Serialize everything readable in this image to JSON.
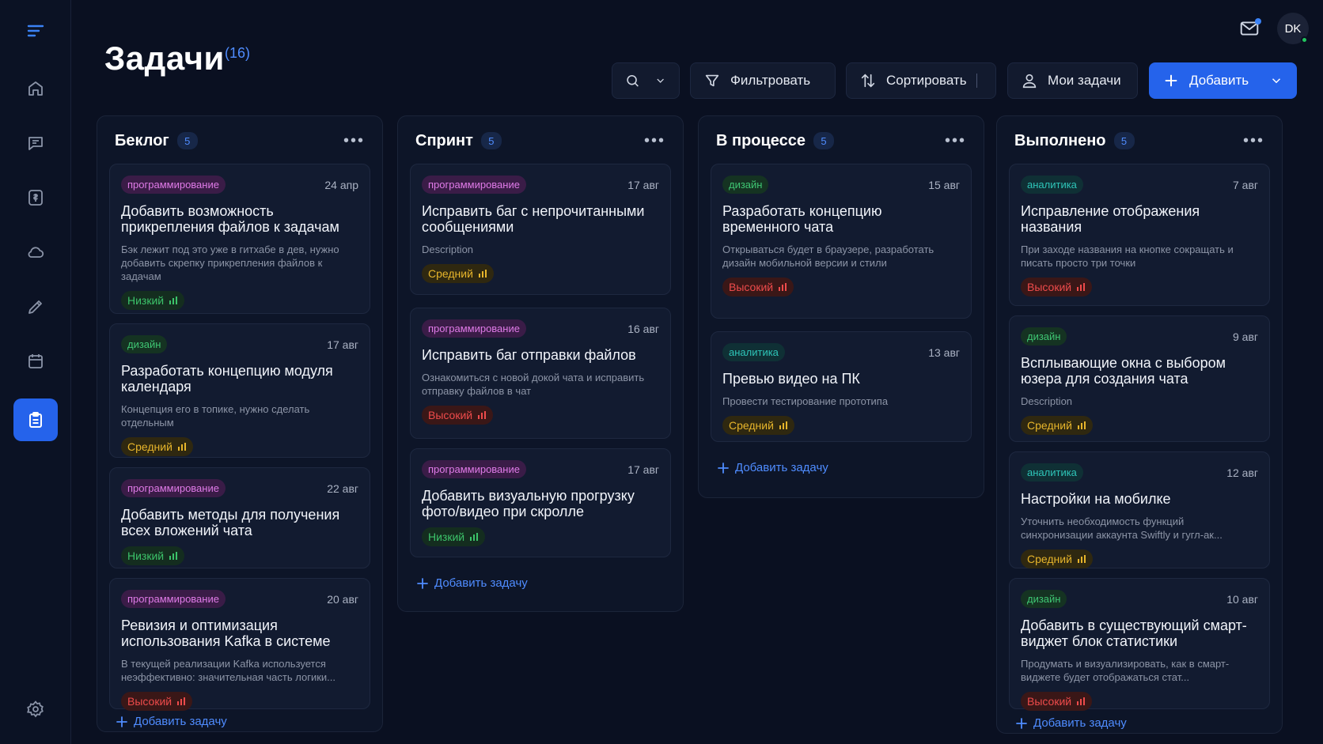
{
  "page": {
    "title": "Задачи",
    "count": "(16)"
  },
  "user": {
    "initials": "DK"
  },
  "toolbar": {
    "filter_label": "Фильтровать",
    "sort_label": "Сортировать",
    "my_tasks_label": "Мои задачи",
    "add_label": "Добавить"
  },
  "add_task_label": "Добавить задачу",
  "columns": [
    {
      "title": "Беклог",
      "count": "5",
      "cards": [
        {
          "tag": "программирование",
          "date": "24 апр",
          "title": "Добавить возможность прикрепления файлов к задачам",
          "desc": "Бэк лежит под это уже в гитхабе в дев, нужно добавить скрепку прикрепления файлов к задачам",
          "priority": "Низкий"
        },
        {
          "tag": "дизайн",
          "date": "17 авг",
          "title": "Разработать концепцию модуля календаря",
          "desc": "Концепция его в топике, нужно сделать отдельным",
          "priority": "Средний"
        },
        {
          "tag": "программирование",
          "date": "22 авг",
          "title": "Добавить методы для получения всех вложений чата",
          "desc": "",
          "priority": "Низкий"
        },
        {
          "tag": "программирование",
          "date": "20 авг",
          "title": "Ревизия и оптимизация использования Kafka в системе",
          "desc": "В текущей реализации Kafka используется неэффективно: значительная часть логики...",
          "priority": "Высокий"
        }
      ]
    },
    {
      "title": "Спринт",
      "count": "5",
      "cards": [
        {
          "tag": "программирование",
          "date": "17 авг",
          "title": "Исправить баг с непрочитанными сообщениями",
          "desc": "Description",
          "priority": "Средний"
        },
        {
          "tag": "программирование",
          "date": "16 авг",
          "title": "Исправить баг отправки файлов",
          "desc": "Ознакомиться с новой докой чата и исправить отправку файлов в чат",
          "priority": "Высокий"
        },
        {
          "tag": "программирование",
          "date": "17 авг",
          "title": "Добавить визуальную прогрузку фото/видео при скролле",
          "desc": "",
          "priority": "Низкий"
        }
      ]
    },
    {
      "title": "В процессе",
      "count": "5",
      "cards": [
        {
          "tag": "дизайн",
          "date": "15 авг",
          "title": "Разработать концепцию временного чата",
          "desc": "Открываться будет в браузере, разработать дизайн мобильной версии и стили",
          "priority": "Высокий"
        },
        {
          "tag": "аналитика",
          "date": "13 авг",
          "title": "Превью видео на ПК",
          "desc": "Провести тестирование прототипа",
          "priority": "Средний"
        }
      ]
    },
    {
      "title": "Выполнено",
      "count": "5",
      "cards": [
        {
          "tag": "аналитика",
          "date": "7 авг",
          "title": "Исправление отображения названия",
          "desc": "При заходе названия на кнопке сокращать и писать просто три точки",
          "priority": "Высокий"
        },
        {
          "tag": "дизайн",
          "date": "9 авг",
          "title": "Всплывающие окна с выбором юзера для создания чата",
          "desc": "Description",
          "priority": "Средний"
        },
        {
          "tag": "аналитика",
          "date": "12 авг",
          "title": "Настройки на мобилке",
          "desc": "Уточнить необходимость функций синхронизации аккаунта Swiftly и гугл-ак...",
          "priority": "Средний"
        },
        {
          "tag": "дизайн",
          "date": "10 авг",
          "title": "Добавить в существующий смарт-виджет блок статистики",
          "desc": "Продумать и визуализировать, как в смарт-виджете будет отображаться стат...",
          "priority": "Высокий"
        }
      ]
    }
  ]
}
